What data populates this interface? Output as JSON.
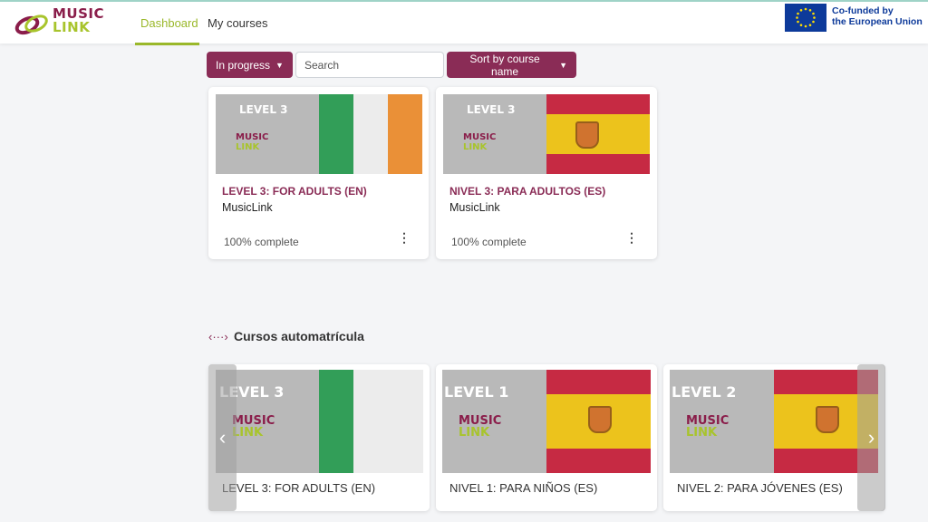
{
  "header": {
    "logo_line1": "MUSIC",
    "logo_line2": "LINK",
    "tabs": [
      {
        "label": "Dashboard",
        "active": true
      },
      {
        "label": "My courses",
        "active": false
      }
    ],
    "eu_line1": "Co-funded by",
    "eu_line2": "the European Union"
  },
  "filters": {
    "status_label": "In progress",
    "search_placeholder": "Search",
    "sort_label": "Sort by course name"
  },
  "courses": [
    {
      "thumb_level": "LEVEL 3",
      "flag": "ireland",
      "title": "LEVEL 3: FOR ADULTS (EN)",
      "category": "MusicLink",
      "progress": "100% complete"
    },
    {
      "thumb_level": "LEVEL 3",
      "flag": "spain",
      "title": "NIVEL 3: PARA ADULTOS (ES)",
      "category": "MusicLink",
      "progress": "100% complete"
    }
  ],
  "section": {
    "icon": "code-brackets-icon",
    "title": "Cursos automatrícula"
  },
  "carousel": [
    {
      "thumb_level": "LEVEL 3",
      "flag": "ireland",
      "title": "LEVEL 3: FOR ADULTS (EN)"
    },
    {
      "thumb_level": "LEVEL 1",
      "flag": "spain",
      "title": "NIVEL 1: PARA NIÑOS (ES)"
    },
    {
      "thumb_level": "LEVEL 2",
      "flag": "spain",
      "title": "NIVEL 2: PARA JÓVENES (ES)"
    }
  ],
  "colors": {
    "brand_maroon": "#8a2c56",
    "brand_green": "#9ab82a",
    "eu_blue": "#0d3a9a"
  },
  "icons": {
    "prev": "chevron-left-icon",
    "next": "chevron-right-icon",
    "menu": "kebab-menu-icon",
    "dropdown": "chevron-down-icon"
  }
}
